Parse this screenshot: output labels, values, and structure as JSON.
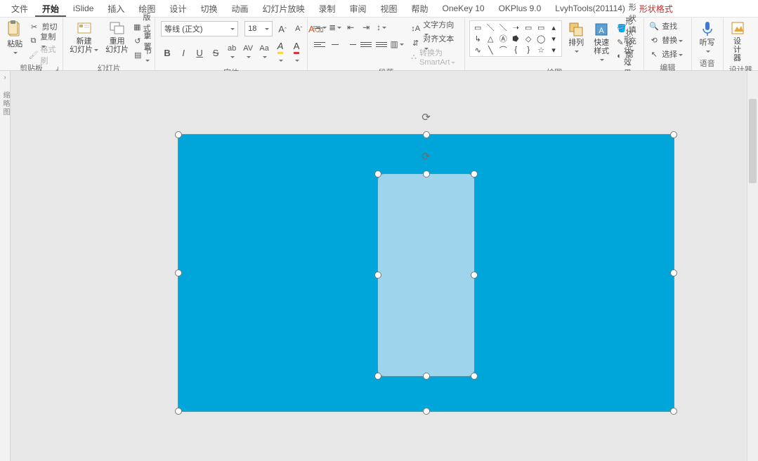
{
  "tabs": {
    "file": "文件",
    "home": "开始",
    "islide": "iSlide",
    "insert": "插入",
    "draw": "绘图",
    "design": "设计",
    "transition": "切换",
    "animation": "动画",
    "slideshow": "幻灯片放映",
    "record": "录制",
    "review": "审阅",
    "view": "视图",
    "help": "帮助",
    "onekey": "OneKey 10",
    "okplus": "OKPlus 9.0",
    "lvyh": "LvyhTools(201114)",
    "format": "形状格式"
  },
  "clipboard": {
    "paste": "粘贴",
    "cut": "剪切",
    "copy": "复制",
    "painter": "格式刷",
    "group": "剪贴板"
  },
  "slides": {
    "newslide": "新建\n幻灯片",
    "reuse": "重用\n幻灯片",
    "layout": "版式",
    "reset": "重置",
    "section": "节",
    "group": "幻灯片"
  },
  "font": {
    "name": "等线 (正文)",
    "size": "18",
    "group": "字体"
  },
  "paragraph": {
    "textdir": "文字方向",
    "align": "对齐文本",
    "smartart": "转换为 SmartArt",
    "group": "段落"
  },
  "drawing": {
    "arrange": "排列",
    "quickstyle": "快速样式",
    "fill": "形状填充",
    "outline": "形状轮廓",
    "effects": "形状效果",
    "group": "绘图"
  },
  "editing": {
    "find": "查找",
    "replace": "替换",
    "select": "选择",
    "group": "编辑"
  },
  "voice": {
    "dictate": "听写",
    "group": "语音"
  },
  "designer": {
    "ideas": "设\n计\n器",
    "group": "设计器"
  },
  "side": {
    "label": "缩略图"
  }
}
